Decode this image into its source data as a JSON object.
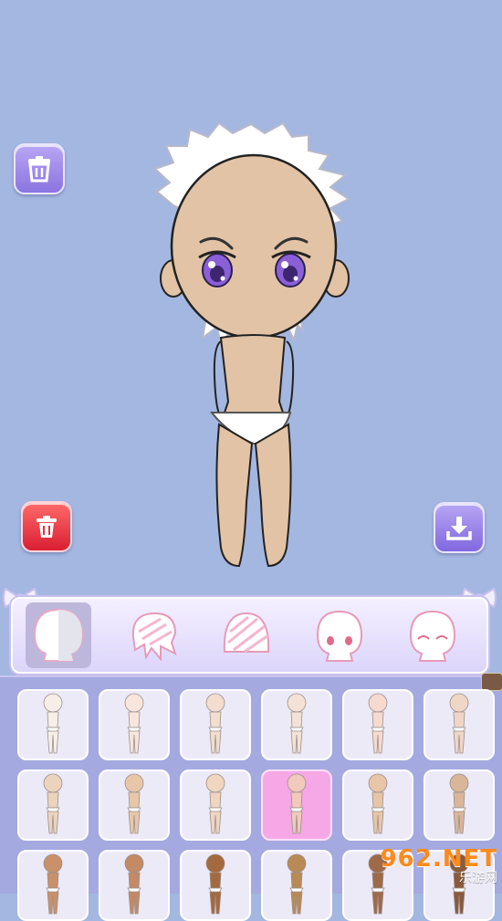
{
  "toolbar": {
    "clear_icon": "clear-all-icon",
    "delete_icon": "trash-icon",
    "save_icon": "download-icon"
  },
  "category_tabs": [
    {
      "id": "body",
      "icon": "body-skin-icon",
      "active": true
    },
    {
      "id": "hair-back",
      "icon": "hair-icon",
      "active": false
    },
    {
      "id": "hair-front",
      "icon": "bangs-icon",
      "active": false
    },
    {
      "id": "eyes",
      "icon": "face-eyes-icon",
      "active": false
    },
    {
      "id": "expression",
      "icon": "face-expression-icon",
      "active": false
    }
  ],
  "skin_options": {
    "selected_index": 9,
    "tones": [
      "#f6efe8",
      "#f8e6dc",
      "#f2ddcf",
      "#f4e2d6",
      "#f6d9cf",
      "#f0d6c6",
      "#ecd3bd",
      "#e8c7a8",
      "#f0d5bf",
      "#f2c9bd",
      "#e7c5a6",
      "#d9b59a",
      "#c9906a",
      "#c48a65",
      "#a5693f",
      "#b98a56",
      "#9f6a4a",
      "#8a5a3a"
    ]
  },
  "colors": {
    "background": "#a3b7e1",
    "skin": "#e2c3a6",
    "eye": "#8a5fd8",
    "selected": "#f6a8e6"
  },
  "watermark": {
    "big": "962.NET",
    "small": "乐游网"
  }
}
